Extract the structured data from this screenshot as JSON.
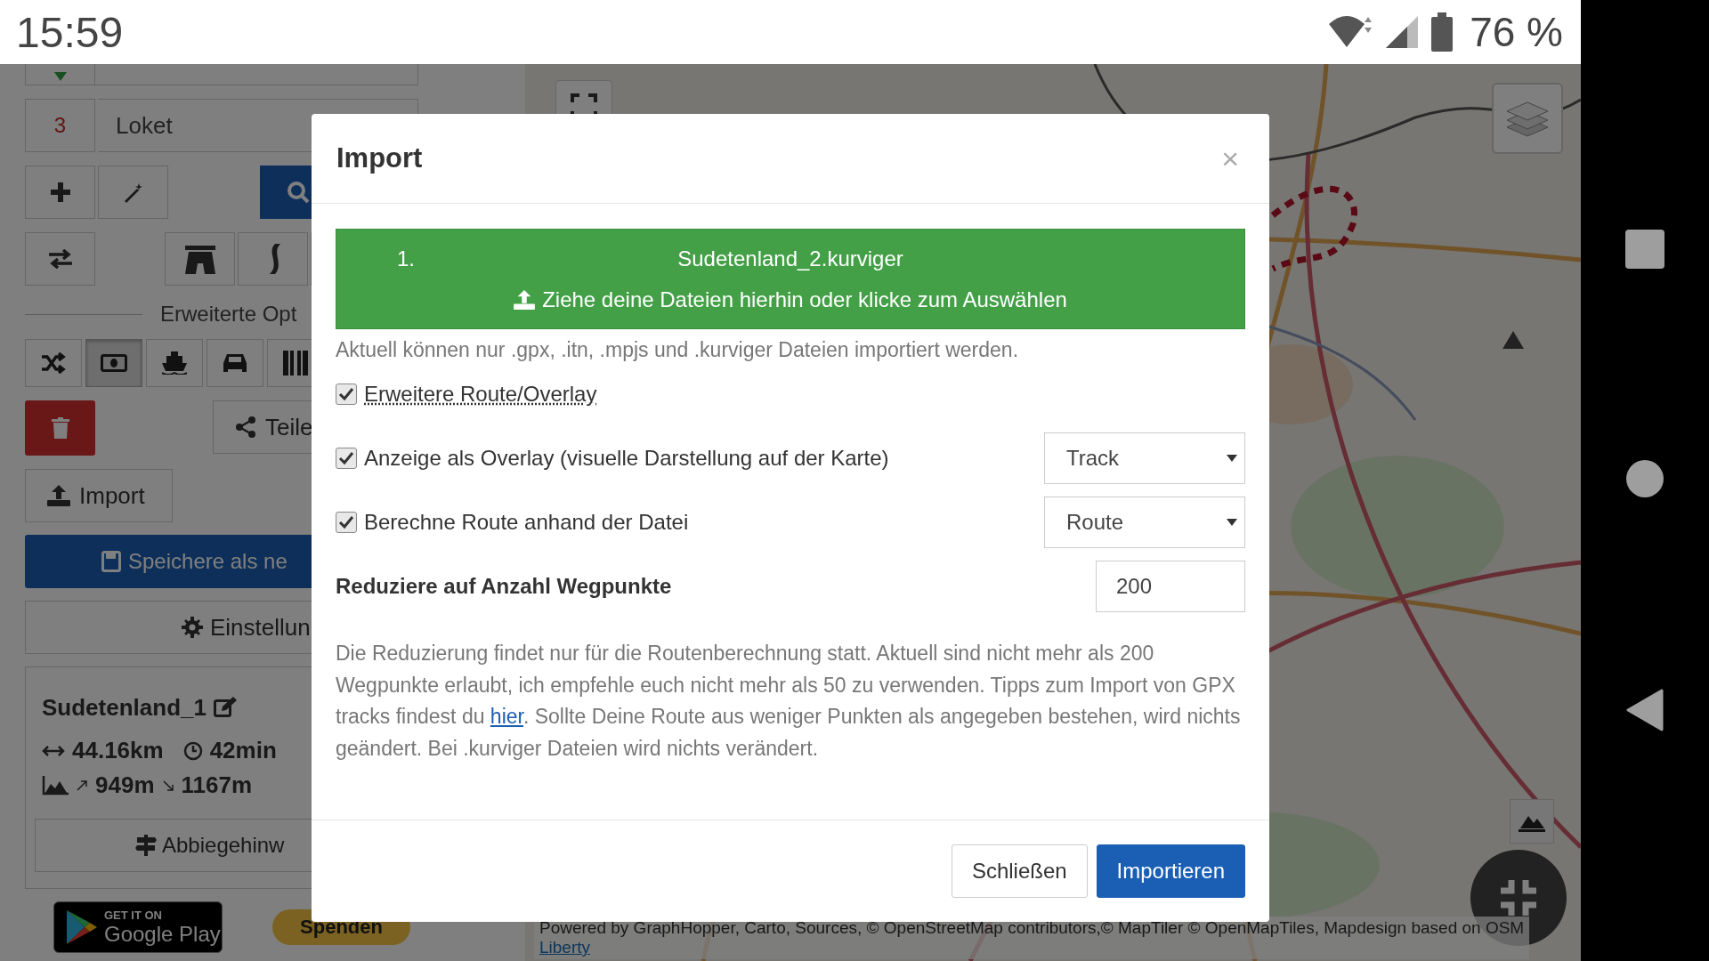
{
  "status_bar": {
    "time": "15:59",
    "battery": "76 %"
  },
  "sidebar": {
    "waypoints": [
      {
        "number": "3",
        "value": "Loket"
      }
    ],
    "section_title": "Erweiterte Opt",
    "avoid_options": [
      {
        "kind": "shuffle",
        "selected": false
      },
      {
        "kind": "toll",
        "selected": true
      },
      {
        "kind": "ferry",
        "selected": false
      },
      {
        "kind": "car",
        "selected": false
      },
      {
        "kind": "barrier",
        "selected": false
      }
    ],
    "share_button": "Teile",
    "import_button": "Import",
    "save_button": "Speichere als ne",
    "settings_button": "Einstellun",
    "route": {
      "name": "Sudetenland_1",
      "distance": "44.16km",
      "duration": "42min",
      "ascent": "949m",
      "descent": "1167m",
      "directions_button": "Abbiegehinw"
    },
    "store_badge": {
      "line_1": "GET IT ON",
      "line_2": "Google Play"
    },
    "donate_button": "Spenden"
  },
  "map": {
    "attribution_lines": [
      "Powered by GraphHopper, Carto, Sources, © OpenStreetMap contributors,© MapTiler © OpenMapTiles, Mapdesign based on OSM",
      "Liberty"
    ]
  },
  "dialog": {
    "title": "Import",
    "close": "×",
    "files": [
      {
        "index": "1.",
        "name": "Sudetenland_2.kurviger"
      }
    ],
    "dropzone_text": "Ziehe deine Dateien hierhin oder klicke zum Auswählen",
    "hint": "Aktuell können nur .gpx, .itn, .mpjs und .kurviger Dateien importiert werden.",
    "options": [
      {
        "label": "Erweitere Route/Overlay",
        "checked": true,
        "underlined": true
      },
      {
        "label": "Anzeige als Overlay (visuelle Darstellung auf der Karte)",
        "checked": true,
        "underlined": false,
        "select": "Track"
      },
      {
        "label": "Berechne Route anhand der Datei",
        "checked": true,
        "underlined": false,
        "select": "Route"
      }
    ],
    "waypoint_limit": {
      "label": "Reduziere auf Anzahl Wegpunkte",
      "value": "200"
    },
    "note": {
      "before": "Die Reduzierung findet nur für die Routenberechnung statt. Aktuell sind nicht mehr als 200 Wegpunkte erlaubt, ich empfehle euch nicht mehr als 50 zu verwenden. Tipps zum Import von GPX tracks findest du ",
      "link": "hier",
      "after": ". Sollte Deine Route aus weniger Punkten als angegeben bestehen, wird nichts geändert. Bei .kurviger Dateien wird nichts verändert."
    },
    "buttons": [
      {
        "label": "Schließen",
        "kind": "secondary"
      },
      {
        "label": "Importieren",
        "kind": "primary"
      }
    ]
  }
}
